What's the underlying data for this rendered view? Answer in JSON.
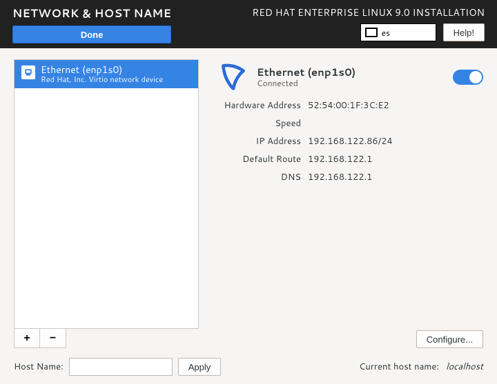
{
  "header": {
    "screen_title": "NETWORK & HOST NAME",
    "product_title": "RED HAT ENTERPRISE LINUX 9.0 INSTALLATION",
    "done_label": "Done",
    "help_label": "Help!",
    "keyboard_layout": "es"
  },
  "devices": {
    "items": [
      {
        "name": "Ethernet (enp1s0)",
        "subtitle": "Red Hat, Inc. Virtio network device"
      }
    ],
    "add_label": "+",
    "remove_label": "−"
  },
  "detail": {
    "title": "Ethernet (enp1s0)",
    "state": "Connected",
    "toggle_on": true,
    "rows": {
      "hw_label": "Hardware Address",
      "hw_value": "52:54:00:1F:3C:E2",
      "speed_label": "Speed",
      "speed_value": "",
      "ip_label": "IP Address",
      "ip_value": "192.168.122.86/24",
      "route_label": "Default Route",
      "route_value": "192.168.122.1",
      "dns_label": "DNS",
      "dns_value": "192.168.122.1"
    },
    "configure_label": "Configure..."
  },
  "hostname": {
    "label": "Host Name:",
    "value": "",
    "apply_label": "Apply",
    "current_label": "Current host name:",
    "current_value": "localhost"
  }
}
